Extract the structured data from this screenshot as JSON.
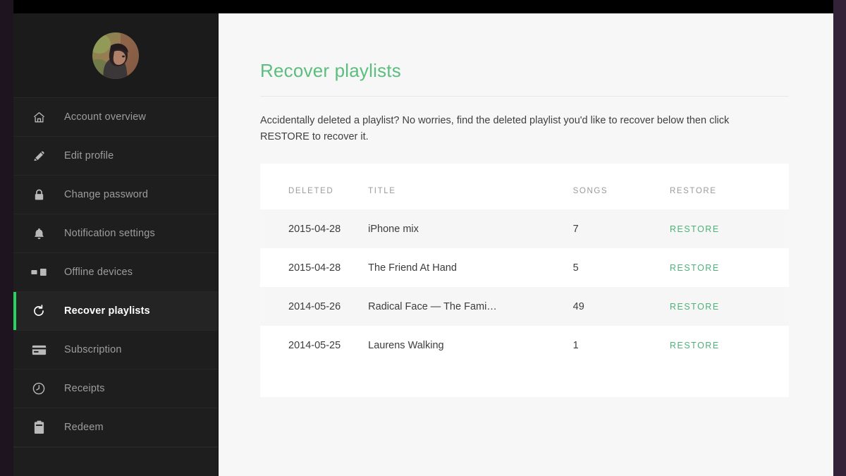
{
  "theme": {
    "accent_green": "#27d45f",
    "title_green": "#5cbd7e",
    "restore_green": "#4cb377",
    "sidebar_bg": "#1e1e1e",
    "main_bg": "#f7f7f7",
    "card_bg": "#ffffff"
  },
  "sidebar": {
    "avatar_alt": "user-profile-photo",
    "items": [
      {
        "label": "Account overview",
        "icon": "home-icon",
        "active": false
      },
      {
        "label": "Edit profile",
        "icon": "pencil-icon",
        "active": false
      },
      {
        "label": "Change password",
        "icon": "lock-icon",
        "active": false
      },
      {
        "label": "Notification settings",
        "icon": "bell-icon",
        "active": false
      },
      {
        "label": "Offline devices",
        "icon": "devices-icon",
        "active": false
      },
      {
        "label": "Recover playlists",
        "icon": "refresh-icon",
        "active": true
      },
      {
        "label": "Subscription",
        "icon": "credit-card-icon",
        "active": false
      },
      {
        "label": "Receipts",
        "icon": "clock-back-icon",
        "active": false
      },
      {
        "label": "Redeem",
        "icon": "gift-card-icon",
        "active": false
      }
    ]
  },
  "main": {
    "page_title": "Recover playlists",
    "intro": "Accidentally deleted a playlist? No worries, find the deleted playlist you'd like to recover below then click RESTORE to recover it.",
    "table": {
      "headers": {
        "deleted": "DELETED",
        "title": "TITLE",
        "songs": "SONGS",
        "restore": "RESTORE"
      },
      "restore_label": "RESTORE",
      "rows": [
        {
          "deleted": "2015-04-28",
          "title": "iPhone mix",
          "songs": "7",
          "restore": "RESTORE"
        },
        {
          "deleted": "2015-04-28",
          "title": "The Friend At Hand",
          "songs": "5",
          "restore": "RESTORE"
        },
        {
          "deleted": "2014-05-26",
          "title": "Radical Face — The Fami…",
          "songs": "49",
          "restore": "RESTORE"
        },
        {
          "deleted": "2014-05-25",
          "title": "Laurens Walking",
          "songs": "1",
          "restore": "RESTORE"
        }
      ]
    }
  }
}
